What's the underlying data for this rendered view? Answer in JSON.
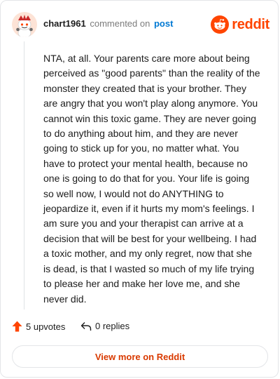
{
  "comment": {
    "username": "chart1961",
    "action_text": "commented on",
    "post_link": "post",
    "body": "NTA, at all. Your parents care more about being perceived as \"good parents\" than the reality of the monster they created that is your brother. They are angry that you won't play along anymore. You cannot win this toxic game. They are never going to do anything about him, and they are never going to stick up for you, no matter what. You have to protect your mental health, because no one is going to do that for you. Your life is going so well now, I would not do ANYTHING to jeopardize it, even if it hurts my mom's feelings. I am sure you and your therapist can arrive at a decision that will be best for your wellbeing. I had a toxic mother, and my only regret, now that she is dead, is that I wasted so much of my life trying to please her and make her love me, and she never did.",
    "upvotes_label": "5 upvotes",
    "replies_label": "0 replies"
  },
  "brand": {
    "name": "reddit",
    "icon": "reddit-logo-icon",
    "color": "#ff4500"
  },
  "footer": {
    "view_more_label": "View more on Reddit"
  },
  "icons": {
    "upvote": "upvote-arrow-icon",
    "reply": "reply-arrow-icon",
    "avatar": "snoo-avatar-icon"
  },
  "colors": {
    "accent": "#ff4500",
    "link": "#0079d3",
    "view_more": "#d93a00"
  }
}
